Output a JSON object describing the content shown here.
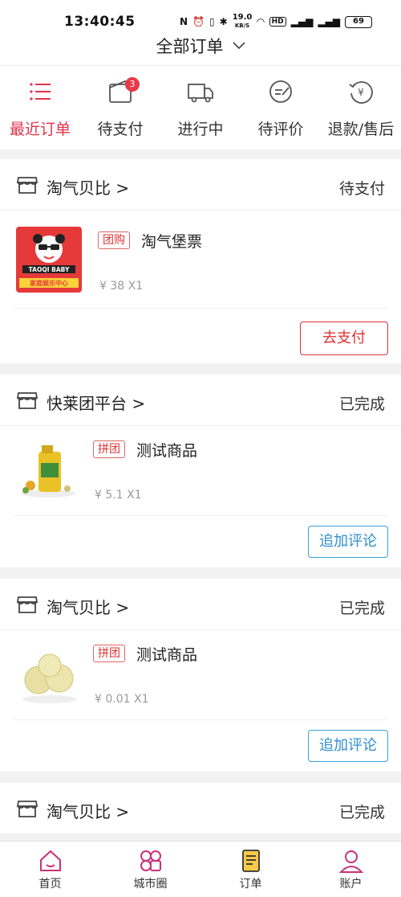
{
  "status_bar": {
    "time": "13:40:45",
    "speed": "19.0",
    "speed_unit": "KB/S",
    "battery": "69"
  },
  "header": {
    "title": "全部订单"
  },
  "tabs": [
    {
      "label": "最近订单",
      "icon": "list-icon",
      "active": true
    },
    {
      "label": "待支付",
      "icon": "wallet-icon",
      "badge": "3"
    },
    {
      "label": "进行中",
      "icon": "truck-icon"
    },
    {
      "label": "待评价",
      "icon": "review-icon"
    },
    {
      "label": "退款/售后",
      "icon": "refund-icon"
    }
  ],
  "orders": [
    {
      "shop": "淘气贝比 >",
      "status": "待支付",
      "tag": "团购",
      "product": "淘气堡票",
      "price": "¥ 38 X1",
      "action": "去支付",
      "logo_text": [
        "TAOQI BABY",
        "家庭娱乐中心"
      ]
    },
    {
      "shop": "快莱团平台 >",
      "status": "已完成",
      "tag": "拼团",
      "product": "测试商品",
      "price": "¥ 5.1 X1",
      "action": "追加评论"
    },
    {
      "shop": "淘气贝比 >",
      "status": "已完成",
      "tag": "拼团",
      "product": "测试商品",
      "price": "¥ 0.01 X1",
      "action": "追加评论"
    },
    {
      "shop": "淘气贝比 >",
      "status": "已完成"
    }
  ],
  "bottom_nav": [
    {
      "label": "首页",
      "icon": "home-icon"
    },
    {
      "label": "城市圈",
      "icon": "city-circle-icon"
    },
    {
      "label": "订单",
      "icon": "order-icon"
    },
    {
      "label": "账户",
      "icon": "account-icon"
    }
  ],
  "colors": {
    "accent": "#e0334b",
    "review_blue": "#2f8fd0",
    "nav_pink": "#c8327a"
  }
}
